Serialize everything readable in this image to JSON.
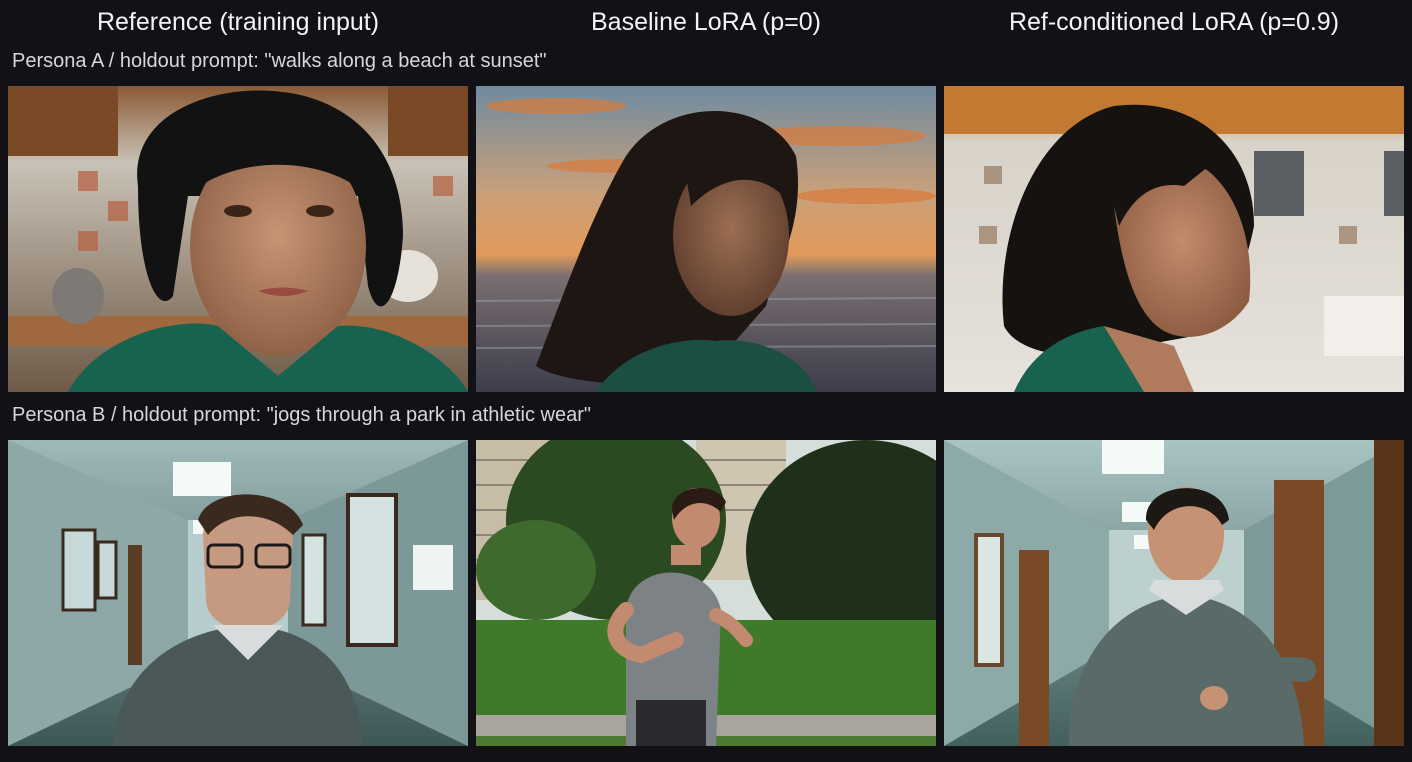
{
  "columns": [
    {
      "label": "Reference (training input)"
    },
    {
      "label": "Baseline LoRA (p=0)"
    },
    {
      "label": "Ref-conditioned LoRA (p=0.9)"
    }
  ],
  "rows": [
    {
      "label": "Persona A / holdout prompt: \"walks along a beach at sunset\""
    },
    {
      "label": "Persona B / holdout prompt: \"jogs through a park in athletic wear\""
    }
  ],
  "images": {
    "a_reference": "woman-in-kitchen-portrait",
    "a_baseline": "woman-at-beach-sunset",
    "a_refcond": "woman-profile-in-kitchen",
    "b_reference": "man-in-hallway-portrait",
    "b_baseline": "man-jogging-in-park",
    "b_refcond": "man-running-in-hallway"
  }
}
